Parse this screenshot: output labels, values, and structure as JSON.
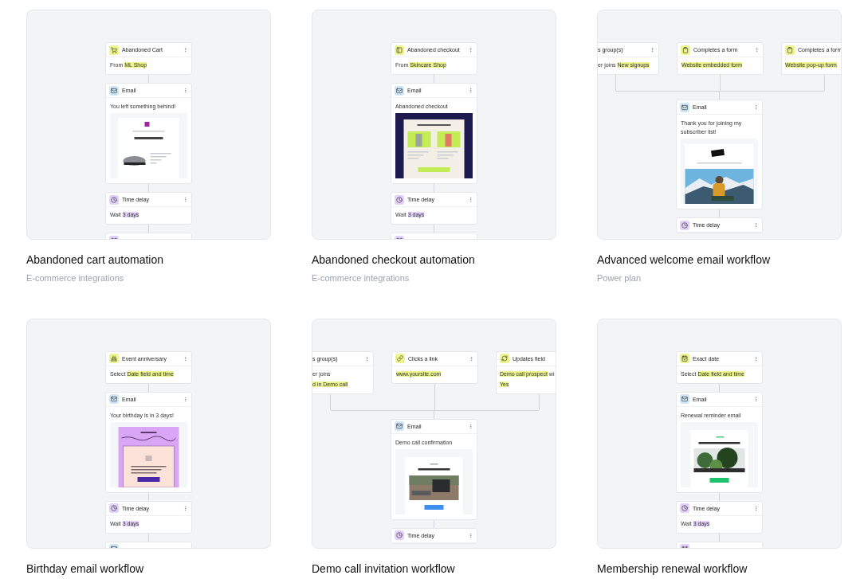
{
  "templates": [
    {
      "title": "Abandoned cart automation",
      "subtitle": "E-commerce integrations",
      "flow": {
        "triggers": [
          {
            "kind": "cart",
            "cut_left": false,
            "cut_right": false,
            "title": "Abandoned Cart",
            "lines": [
              [
                {
                  "text": "From ",
                  "highlight": false
                },
                {
                  "text": "ML Shop",
                  "highlight": true
                }
              ]
            ]
          }
        ],
        "steps": [
          {
            "kind": "email",
            "title": "Email",
            "lines": [
              [
                {
                  "text": "You left something behind!",
                  "highlight": false
                }
              ]
            ],
            "preview": {
              "kind": "picture"
            }
          },
          {
            "kind": "delay",
            "title": "Time delay",
            "lines": [
              [
                {
                  "text": "Wait ",
                  "highlight": false
                },
                {
                  "text": "3 days",
                  "highlight": true
                }
              ]
            ]
          },
          {
            "kind": "condition"
          }
        ]
      }
    },
    {
      "title": "Abandoned checkout automation",
      "subtitle": "E-commerce integrations",
      "flow": {
        "triggers": [
          {
            "kind": "checkout",
            "cut_left": false,
            "cut_right": false,
            "title": "Abandoned checkout",
            "lines": [
              [
                {
                  "text": "From ",
                  "highlight": false
                },
                {
                  "text": "Skincare Shop",
                  "highlight": true
                }
              ]
            ]
          }
        ],
        "steps": [
          {
            "kind": "email",
            "title": "Email",
            "lines": [
              [
                {
                  "text": "Abandoned checkout",
                  "highlight": false
                }
              ]
            ],
            "preview": {
              "kind": "picture"
            }
          },
          {
            "kind": "delay",
            "title": "Time delay",
            "lines": [
              [
                {
                  "text": "Wait ",
                  "highlight": false
                },
                {
                  "text": "3 days",
                  "highlight": true
                }
              ]
            ]
          },
          {
            "kind": "condition"
          }
        ]
      }
    },
    {
      "title": "Advanced welcome email workflow",
      "subtitle": "Power plan",
      "flow": {
        "triggers": [
          {
            "cut_left": true,
            "cut_right": false,
            "title": "s group(s)",
            "lines": [
              [
                {
                  "text": "er joins ",
                  "highlight": false
                },
                {
                  "text": "New signups",
                  "highlight": true
                }
              ]
            ]
          },
          {
            "kind": "form",
            "cut_left": false,
            "cut_right": false,
            "title": "Completes a form",
            "lines": [
              [
                {
                  "text": "Website embedded form",
                  "highlight": true
                }
              ]
            ]
          },
          {
            "kind": "form",
            "cut_left": false,
            "cut_right": true,
            "title": "Completes a form",
            "lines": [
              [
                {
                  "text": "Website pop-up form",
                  "highlight": true
                }
              ]
            ]
          }
        ],
        "steps": [
          {
            "kind": "email",
            "title": "Email",
            "lines": [
              [
                {
                  "text": "Thank you for joining my subscriber list!",
                  "highlight": false
                }
              ]
            ],
            "preview": {
              "kind": "picture"
            }
          },
          {
            "kind": "delay",
            "title": "Time delay"
          }
        ]
      }
    },
    {
      "title": "Birthday email workflow",
      "flow": {
        "triggers": [
          {
            "kind": "anniversary",
            "cut_left": false,
            "cut_right": false,
            "title": "Event anniversary",
            "lines": [
              [
                {
                  "text": "Select ",
                  "highlight": false
                },
                {
                  "text": "Date field and time",
                  "highlight": true
                }
              ]
            ]
          }
        ],
        "steps": [
          {
            "kind": "email",
            "title": "Email",
            "lines": [
              [
                {
                  "text": "Your birthday is in 3 days!",
                  "highlight": false
                }
              ]
            ],
            "preview": {
              "kind": "picture"
            }
          },
          {
            "kind": "delay",
            "title": "Time delay",
            "lines": [
              [
                {
                  "text": "Wait ",
                  "highlight": false
                },
                {
                  "text": "3 days",
                  "highlight": true
                }
              ]
            ]
          },
          {
            "kind": "email"
          }
        ]
      }
    },
    {
      "title": "Demo call invitation workflow",
      "flow": {
        "triggers": [
          {
            "cut_left": true,
            "cut_right": false,
            "title": "s group(s)",
            "lines": [
              [
                {
                  "text": "er joins",
                  "highlight": false
                }
              ],
              [
                {
                  "text": "d in Demo call",
                  "highlight": true
                }
              ]
            ]
          },
          {
            "kind": "link",
            "cut_left": false,
            "cut_right": false,
            "title": "Clicks a link",
            "lines": [
              [
                {
                  "text": "www.yoursite.com",
                  "highlight": true
                }
              ]
            ]
          },
          {
            "kind": "field",
            "cut_left": false,
            "cut_right": true,
            "title": "Updates field",
            "lines": [
              [
                {
                  "text": "Demo call prospect",
                  "highlight": true
                },
                {
                  "text": " wi",
                  "highlight": false
                }
              ],
              [
                {
                  "text": "Yes",
                  "highlight": true
                }
              ]
            ]
          }
        ],
        "steps": [
          {
            "kind": "email",
            "title": "Email",
            "lines": [
              [
                {
                  "text": "Demo call confirmation",
                  "highlight": false
                }
              ]
            ],
            "preview": {
              "kind": "picture"
            }
          },
          {
            "kind": "delay",
            "title": "Time delay"
          }
        ]
      }
    },
    {
      "title": "Membership renewal workflow",
      "flow": {
        "triggers": [
          {
            "kind": "date",
            "cut_left": false,
            "cut_right": false,
            "title": "Exact date",
            "lines": [
              [
                {
                  "text": "Select ",
                  "highlight": false
                },
                {
                  "text": "Date field and time",
                  "highlight": true
                }
              ]
            ]
          }
        ],
        "steps": [
          {
            "kind": "email",
            "title": "Email",
            "lines": [
              [
                {
                  "text": "Renewal reminder email",
                  "highlight": false
                }
              ]
            ],
            "preview": {
              "kind": "picture"
            }
          },
          {
            "kind": "delay",
            "title": "Time delay",
            "lines": [
              [
                {
                  "text": "Wait ",
                  "highlight": false
                },
                {
                  "text": "3 days",
                  "highlight": true
                }
              ]
            ]
          },
          {
            "kind": "condition"
          }
        ]
      }
    }
  ]
}
